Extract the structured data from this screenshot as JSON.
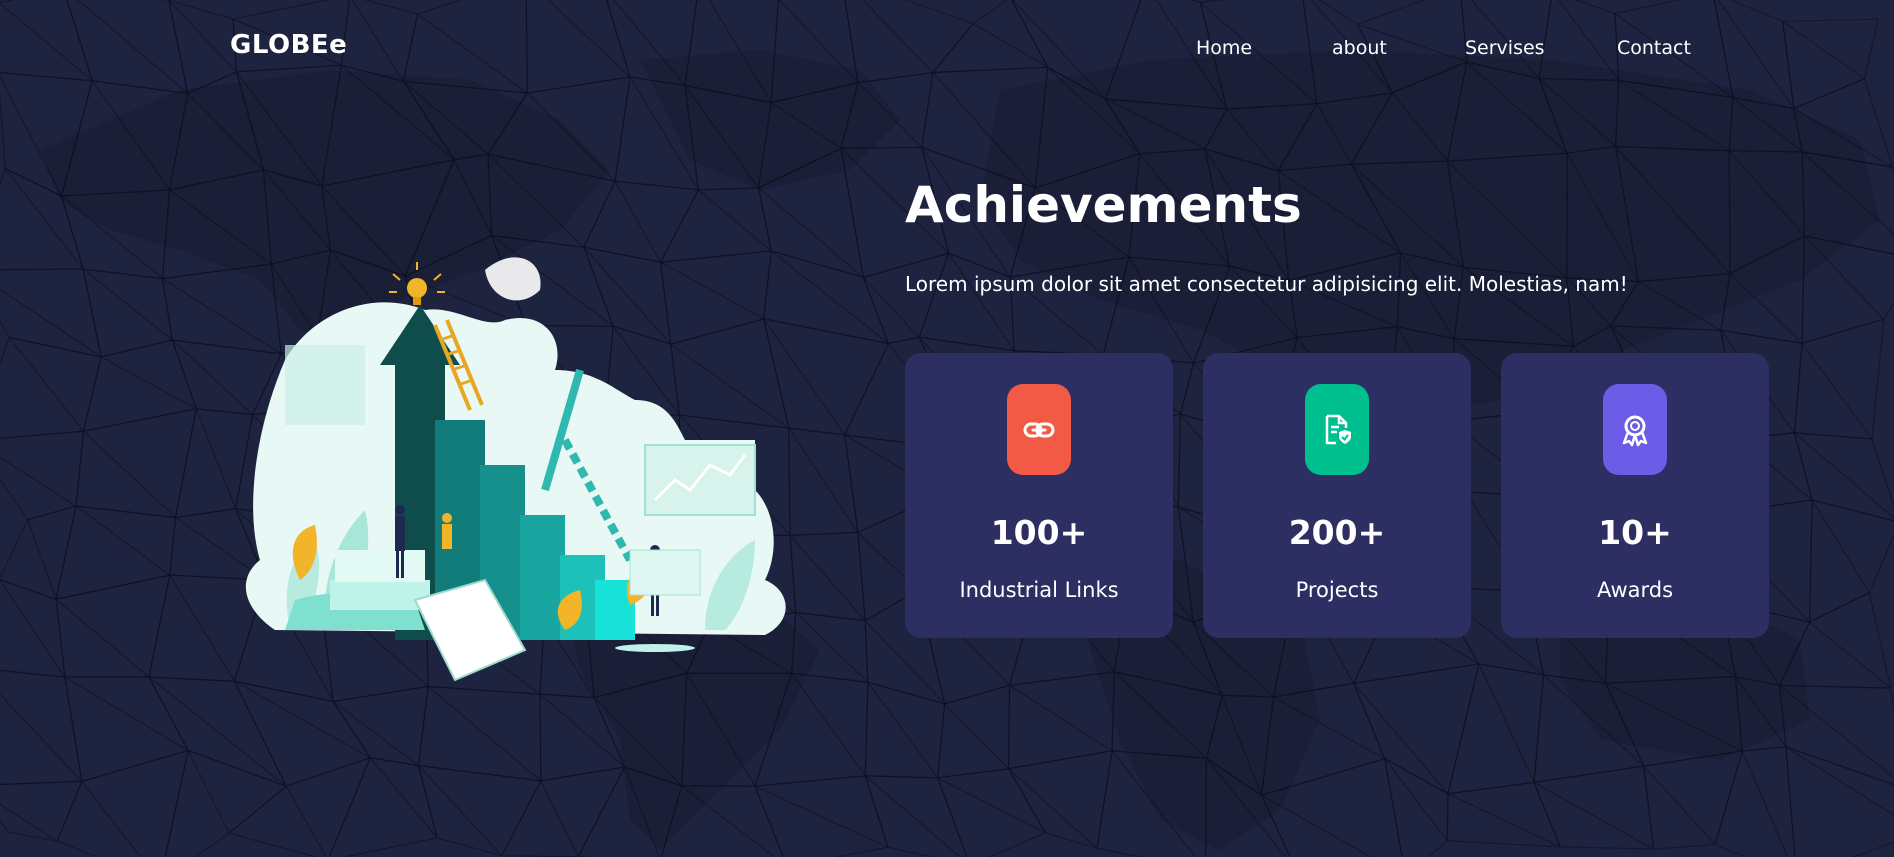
{
  "header": {
    "logo": "GLOBEe",
    "nav": [
      {
        "label": "Home"
      },
      {
        "label": "about"
      },
      {
        "label": "Servises"
      },
      {
        "label": "Contact"
      }
    ]
  },
  "hero": {
    "title": "Achievements",
    "subtitle": "Lorem ipsum dolor sit amet consectetur adipisicing elit. Molestias, nam!"
  },
  "cards": [
    {
      "icon": "link-icon",
      "value": "100+",
      "label": "Industrial Links",
      "icon_color": "#f25a45"
    },
    {
      "icon": "document-shield-icon",
      "value": "200+",
      "label": "Projects",
      "icon_color": "#00bf8f"
    },
    {
      "icon": "award-ribbon-icon",
      "value": "10+",
      "label": "Awards",
      "icon_color": "#6c5ce7"
    }
  ],
  "colors": {
    "background": "#1e2340",
    "card": "#2d2f63",
    "text": "#ffffff"
  }
}
